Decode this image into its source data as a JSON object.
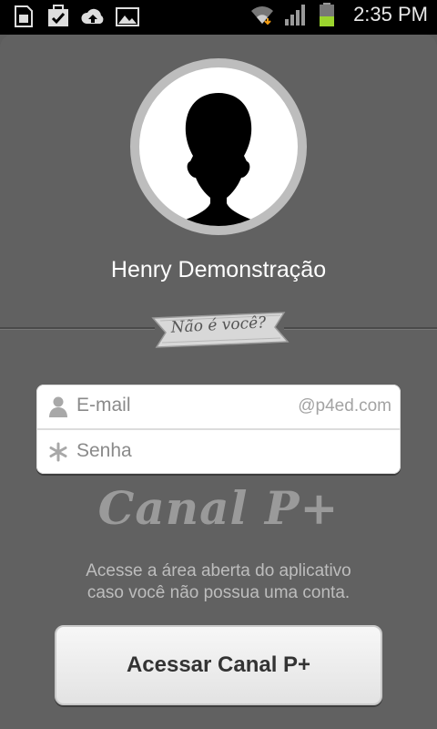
{
  "status_bar": {
    "time": "2:35 PM",
    "icons": [
      "sim-card-icon",
      "task-check-icon",
      "cloud-upload-icon",
      "gallery-icon",
      "wifi-icon",
      "signal-icon",
      "battery-icon"
    ]
  },
  "profile": {
    "name": "Henry Demonstração",
    "avatar_icon": "person-silhouette-icon"
  },
  "switch_user": {
    "label": "Não é você?"
  },
  "login": {
    "email_placeholder": "E-mail",
    "email_domain": "@p4ed.com",
    "password_placeholder": "Senha"
  },
  "brand": {
    "logo_text": "Canal P+"
  },
  "guest_info": {
    "line1": "Acesse a área aberta do aplicativo",
    "line2": "caso você não possua uma conta."
  },
  "guest_button": {
    "label": "Acessar Canal P+"
  },
  "colors": {
    "background": "#616161",
    "button_text": "#333333",
    "logo": "#9a9a9a"
  }
}
